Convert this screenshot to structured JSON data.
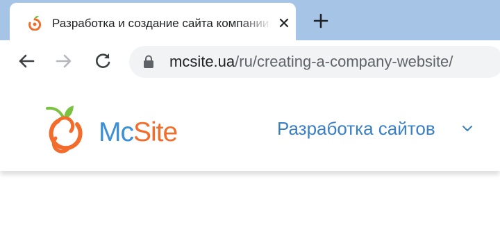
{
  "browser": {
    "tab": {
      "title": "Разработка и создание сайта компании",
      "close_glyph": "✕"
    },
    "address_bar": {
      "host": "mcsite.ua",
      "path": "/ru/creating-a-company-website/"
    }
  },
  "site": {
    "logo": {
      "part1": "Mc",
      "part2": "Site"
    },
    "nav": {
      "development_label": "Разработка сайтов"
    }
  },
  "colors": {
    "tabstrip": "#a6c4e6",
    "logo_blue": "#3a8fd6",
    "logo_orange": "#f26d2c",
    "logo_green": "#7cc242",
    "nav_link": "#3a7fc4"
  },
  "icons": [
    "favicon-icon",
    "close-icon",
    "plus-icon",
    "back-arrow-icon",
    "forward-arrow-icon",
    "reload-icon",
    "lock-icon",
    "logo-icon",
    "chevron-down-icon"
  ]
}
